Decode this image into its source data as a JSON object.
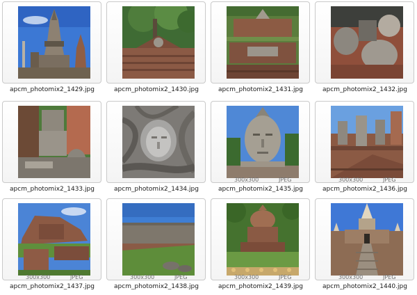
{
  "gallery": {
    "items": [
      {
        "filename": "apcm_photomix2_1429.jpg",
        "dimensions": "",
        "format": "",
        "scene": "temple-prang-sky"
      },
      {
        "filename": "apcm_photomix2_1430.jpg",
        "dimensions": "",
        "format": "",
        "scene": "ruin-tree"
      },
      {
        "filename": "apcm_photomix2_1431.jpg",
        "dimensions": "",
        "format": "",
        "scene": "brick-platform"
      },
      {
        "filename": "apcm_photomix2_1432.jpg",
        "dimensions": "",
        "format": "",
        "scene": "fallen-buddha"
      },
      {
        "filename": "apcm_photomix2_1433.jpg",
        "dimensions": "",
        "format": "",
        "scene": "headless-statue"
      },
      {
        "filename": "apcm_photomix2_1434.jpg",
        "dimensions": "",
        "format": "",
        "scene": "head-in-roots"
      },
      {
        "filename": "apcm_photomix2_1435.jpg",
        "dimensions": "300x300",
        "format": "JPEG",
        "scene": "buddha-head-sky"
      },
      {
        "filename": "apcm_photomix2_1436.jpg",
        "dimensions": "300x300",
        "format": "JPEG",
        "scene": "statue-row"
      },
      {
        "filename": "apcm_photomix2_1437.jpg",
        "dimensions": "300x300",
        "format": "JPEG",
        "scene": "ruins-lawn"
      },
      {
        "filename": "apcm_photomix2_1438.jpg",
        "dimensions": "300x300",
        "format": "JPEG",
        "scene": "wall-lawn"
      },
      {
        "filename": "apcm_photomix2_1439.jpg",
        "dimensions": "300x300",
        "format": "JPEG",
        "scene": "stupa-lawn"
      },
      {
        "filename": "apcm_photomix2_1440.jpg",
        "dimensions": "300x300",
        "format": "JPEG",
        "scene": "prang-staircase"
      }
    ]
  },
  "colors": {
    "sky": "#4a86d8",
    "brick": "#8a5a45",
    "stone": "#9a958c",
    "grass": "#5d8a3a"
  }
}
